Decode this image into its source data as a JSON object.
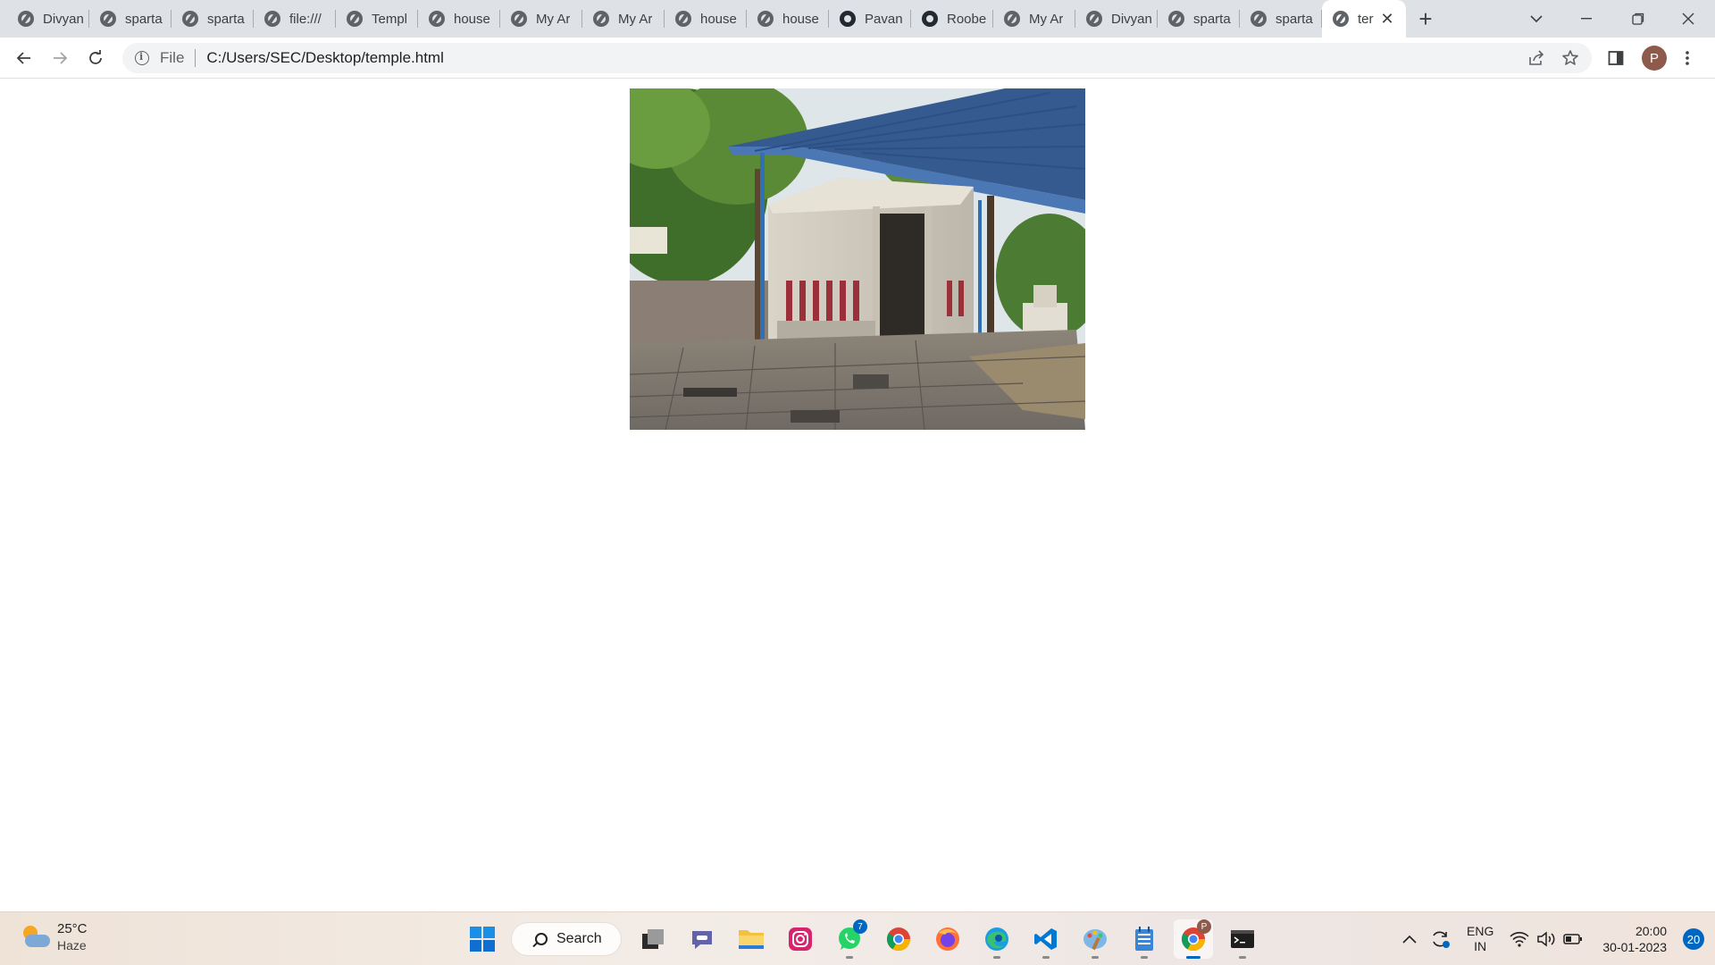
{
  "browser": {
    "tabs": [
      {
        "title": "Divyan",
        "icon": "globe-icon"
      },
      {
        "title": "sparta",
        "icon": "globe-icon"
      },
      {
        "title": "sparta",
        "icon": "globe-icon"
      },
      {
        "title": "file:///",
        "icon": "globe-icon"
      },
      {
        "title": "Templ",
        "icon": "globe-icon"
      },
      {
        "title": "house",
        "icon": "globe-icon"
      },
      {
        "title": "My Ar",
        "icon": "globe-icon"
      },
      {
        "title": "My Ar",
        "icon": "globe-icon"
      },
      {
        "title": "house",
        "icon": "globe-icon"
      },
      {
        "title": "house",
        "icon": "globe-icon"
      },
      {
        "title": "Pavan",
        "icon": "github-icon"
      },
      {
        "title": "Roobe",
        "icon": "github-icon"
      },
      {
        "title": "My Ar",
        "icon": "globe-icon"
      },
      {
        "title": "Divyan",
        "icon": "globe-icon"
      },
      {
        "title": "sparta",
        "icon": "globe-icon"
      },
      {
        "title": "sparta",
        "icon": "globe-icon"
      }
    ],
    "active_tab": {
      "title": "ter",
      "icon": "globe-icon"
    },
    "address": {
      "scheme_label": "File",
      "url": "C:/Users/SEC/Desktop/temple.html"
    },
    "profile_initial": "P"
  },
  "taskbar": {
    "weather": {
      "temp": "25°C",
      "condition": "Haze"
    },
    "search_label": "Search",
    "whatsapp_badge": "7",
    "chrome_profile_badge": "P",
    "language": {
      "line1": "ENG",
      "line2": "IN"
    },
    "time": "20:00",
    "date": "30-01-2023",
    "notification_count": "20"
  },
  "colors": {
    "chrome_frame": "#dee1e6",
    "accent": "#0067c0"
  }
}
